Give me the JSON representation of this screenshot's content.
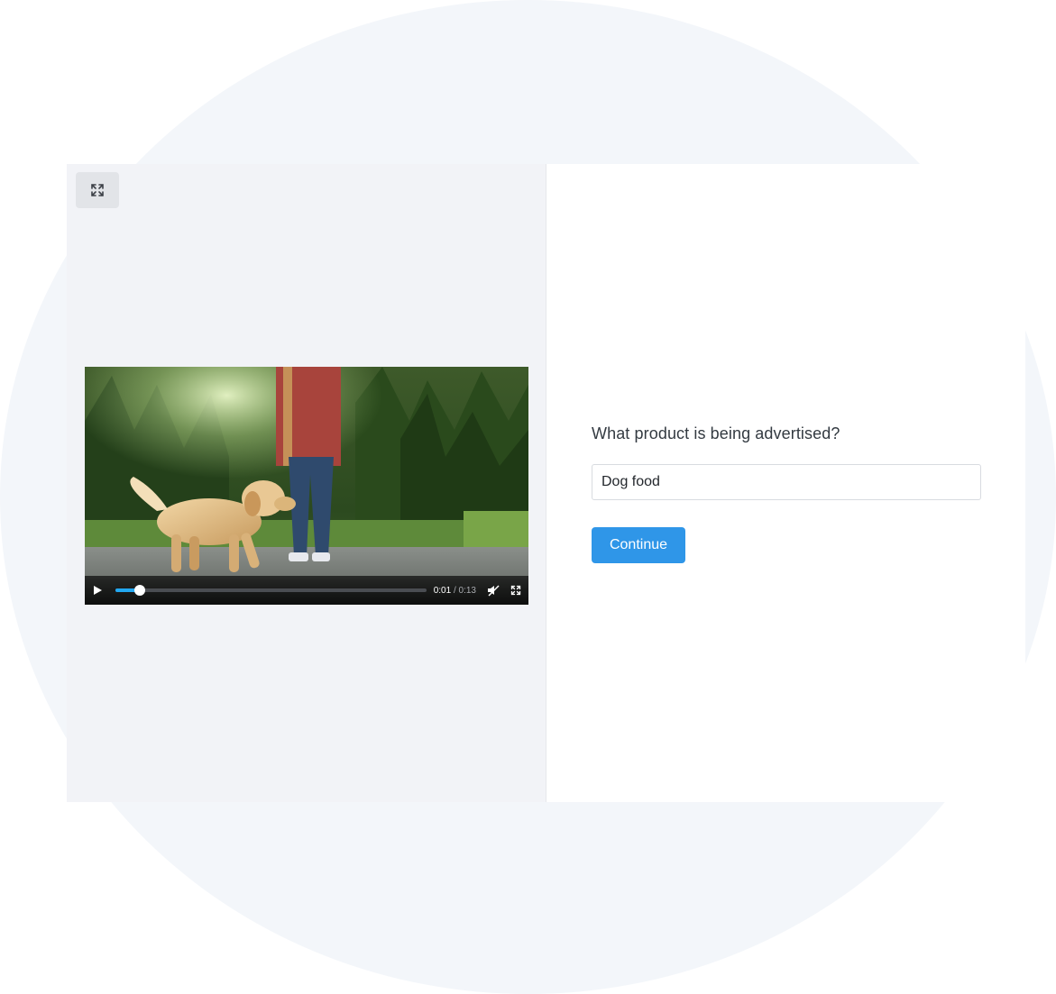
{
  "question": {
    "text": "What product is being advertised?"
  },
  "answer": {
    "value": "Dog food",
    "placeholder": ""
  },
  "continue_button": {
    "label": "Continue"
  },
  "video_player": {
    "current_time": "0:01",
    "separator": "/",
    "duration": "0:13",
    "progress_fraction": 0.077,
    "muted": true
  },
  "icons": {
    "expand": "expand-icon",
    "play": "play-icon",
    "mute": "volume-muted-icon",
    "fullscreen": "fullscreen-icon"
  },
  "colors": {
    "accent": "#2f96e8",
    "progress": "#22a7f0",
    "panel_bg": "#f2f3f7",
    "page_blob": "#f3f6fa"
  }
}
